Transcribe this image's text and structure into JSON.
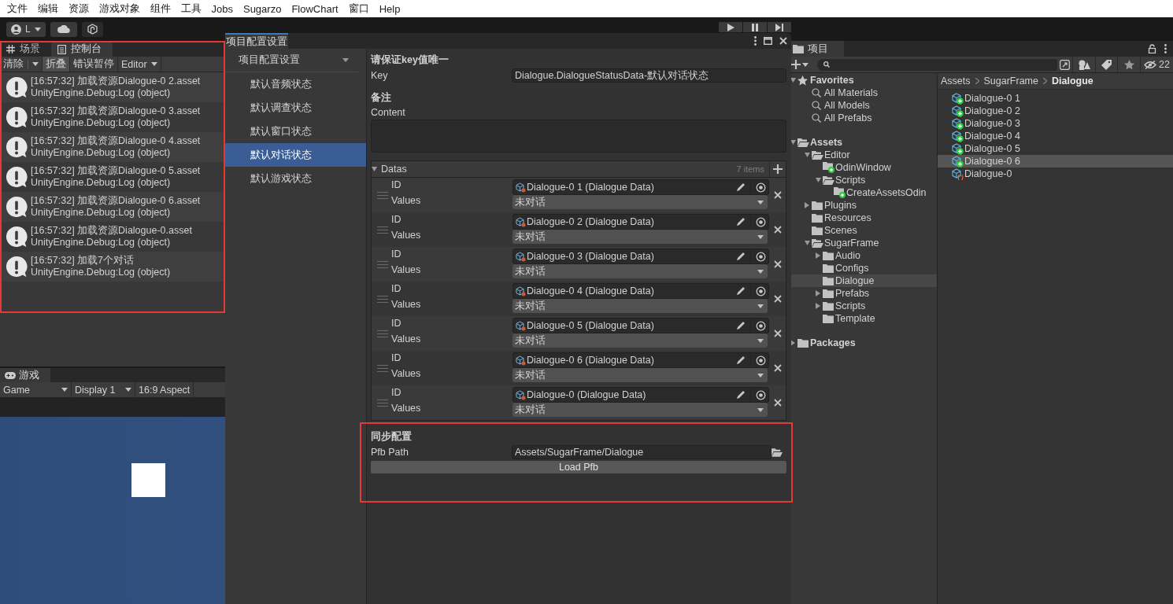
{
  "menu_bar": [
    "文件",
    "编辑",
    "资源",
    "游戏对象",
    "组件",
    "工具",
    "Jobs",
    "Sugarzo",
    "FlowChart",
    "窗口",
    "Help"
  ],
  "toolbar": {
    "account": "L"
  },
  "console": {
    "highlighted": true,
    "tabs": [
      {
        "label": "场景",
        "kind": "scene",
        "selected": false
      },
      {
        "label": "控制台",
        "kind": "console",
        "selected": true
      }
    ],
    "buttons": [
      {
        "label": "清除",
        "kind": "split",
        "on": false
      },
      {
        "label": "折叠",
        "kind": "toggle",
        "on": true
      },
      {
        "label": "错误暂停",
        "kind": "toggle",
        "on": false
      },
      {
        "label": "Editor",
        "kind": "dropdown"
      }
    ],
    "logs": [
      {
        "message": "[16:57:32] 加载资源Dialogue-0 2.asset",
        "source": "UnityEngine.Debug:Log (object)"
      },
      {
        "message": "[16:57:32] 加载资源Dialogue-0 3.asset",
        "source": "UnityEngine.Debug:Log (object)"
      },
      {
        "message": "[16:57:32] 加载资源Dialogue-0 4.asset",
        "source": "UnityEngine.Debug:Log (object)"
      },
      {
        "message": "[16:57:32] 加载资源Dialogue-0 5.asset",
        "source": "UnityEngine.Debug:Log (object)"
      },
      {
        "message": "[16:57:32] 加载资源Dialogue-0 6.asset",
        "source": "UnityEngine.Debug:Log (object)"
      },
      {
        "message": "[16:57:32] 加载资源Dialogue-0.asset",
        "source": "UnityEngine.Debug:Log (object)"
      },
      {
        "message": "[16:57:32] 加载7个对话",
        "source": "UnityEngine.Debug:Log (object)"
      }
    ]
  },
  "game": {
    "tabs": [
      {
        "label": "游戏",
        "selected": true
      }
    ],
    "controls": [
      {
        "label": "Game",
        "kind": "dropdown"
      },
      {
        "label": "Display 1",
        "kind": "dropdown"
      },
      {
        "label": "16:9 Aspect",
        "kind": "plain"
      }
    ]
  },
  "settings_window": {
    "title": "项目配置设置",
    "menu_header": "项目配置设置",
    "menu": [
      {
        "label": "默认音频状态",
        "selected": false
      },
      {
        "label": "默认调查状态",
        "selected": false
      },
      {
        "label": "默认窗口状态",
        "selected": false
      },
      {
        "label": "默认对话状态",
        "selected": true
      },
      {
        "label": "默认游戏状态",
        "selected": false
      }
    ],
    "key_section": {
      "title": "请保证key值唯一",
      "key_label": "Key",
      "key_value": "Dialogue.DialogueStatusData-默认对话状态"
    },
    "note_section": {
      "title": "备注",
      "content_label": "Content"
    },
    "datas": {
      "title": "Datas",
      "expanded": true,
      "count": "7 items",
      "rows": [
        {
          "id_label": "ID",
          "id_value": "Dialogue-0 1 (Dialogue Data)",
          "values_label": "Values",
          "values_value": "未对话"
        },
        {
          "id_label": "ID",
          "id_value": "Dialogue-0 2 (Dialogue Data)",
          "values_label": "Values",
          "values_value": "未对话"
        },
        {
          "id_label": "ID",
          "id_value": "Dialogue-0 3 (Dialogue Data)",
          "values_label": "Values",
          "values_value": "未对话"
        },
        {
          "id_label": "ID",
          "id_value": "Dialogue-0 4 (Dialogue Data)",
          "values_label": "Values",
          "values_value": "未对话"
        },
        {
          "id_label": "ID",
          "id_value": "Dialogue-0 5 (Dialogue Data)",
          "values_label": "Values",
          "values_value": "未对话"
        },
        {
          "id_label": "ID",
          "id_value": "Dialogue-0 6 (Dialogue Data)",
          "values_label": "Values",
          "values_value": "未对话"
        },
        {
          "id_label": "ID",
          "id_value": "Dialogue-0 (Dialogue Data)",
          "values_label": "Values",
          "values_value": "未对话"
        }
      ]
    },
    "sync_section": {
      "title": "同步配置",
      "highlighted": true,
      "path_label": "Pfb Path",
      "path_value": "Assets/SugarFrame/Dialogue",
      "button": "Load Pfb"
    }
  },
  "project": {
    "tab": "项目",
    "hidden_count": "22",
    "breadcrumb": [
      "Assets",
      "SugarFrame",
      "Dialogue"
    ],
    "tree": [
      {
        "label": "Favorites",
        "kind": "favorites",
        "expanded": true,
        "selected": false,
        "children": [
          {
            "label": "All Materials",
            "kind": "search",
            "selected": false
          },
          {
            "label": "All Models",
            "kind": "search",
            "selected": false
          },
          {
            "label": "All Prefabs",
            "kind": "search",
            "selected": false
          }
        ]
      },
      {
        "label": "Assets",
        "kind": "folder",
        "expanded": true,
        "selected": false,
        "children": [
          {
            "label": "Editor",
            "kind": "folder",
            "expanded": true,
            "selected": false,
            "children": [
              {
                "label": "OdinWindow",
                "kind": "script-folder",
                "selected": false
              },
              {
                "label": "Scripts",
                "kind": "folder",
                "expanded": true,
                "selected": false,
                "children": [
                  {
                    "label": "CreateAssetsOdin",
                    "kind": "script-folder",
                    "selected": false
                  }
                ]
              }
            ]
          },
          {
            "label": "Plugins",
            "kind": "folder",
            "expanded": false,
            "selected": false
          },
          {
            "label": "Resources",
            "kind": "folder",
            "selected": false
          },
          {
            "label": "Scenes",
            "kind": "folder",
            "selected": false
          },
          {
            "label": "SugarFrame",
            "kind": "folder",
            "expanded": true,
            "selected": false,
            "children": [
              {
                "label": "Audio",
                "kind": "folder",
                "expanded": false,
                "selected": false
              },
              {
                "label": "Configs",
                "kind": "folder",
                "selected": false
              },
              {
                "label": "Dialogue",
                "kind": "folder",
                "selected": true
              },
              {
                "label": "Prefabs",
                "kind": "folder",
                "expanded": false,
                "selected": false
              },
              {
                "label": "Scripts",
                "kind": "folder",
                "expanded": false,
                "selected": false
              },
              {
                "label": "Template",
                "kind": "folder",
                "selected": false
              }
            ]
          }
        ]
      },
      {
        "label": "Packages",
        "kind": "folder",
        "expanded": false,
        "selected": false
      }
    ],
    "assets": [
      {
        "label": "Dialogue-0 1",
        "kind": "instance",
        "selected": false
      },
      {
        "label": "Dialogue-0 2",
        "kind": "instance",
        "selected": false
      },
      {
        "label": "Dialogue-0 3",
        "kind": "instance",
        "selected": false
      },
      {
        "label": "Dialogue-0 4",
        "kind": "instance",
        "selected": false
      },
      {
        "label": "Dialogue-0 5",
        "kind": "instance",
        "selected": false
      },
      {
        "label": "Dialogue-0 6",
        "kind": "instance",
        "selected": true
      },
      {
        "label": "Dialogue-0",
        "kind": "script",
        "selected": false
      }
    ]
  }
}
